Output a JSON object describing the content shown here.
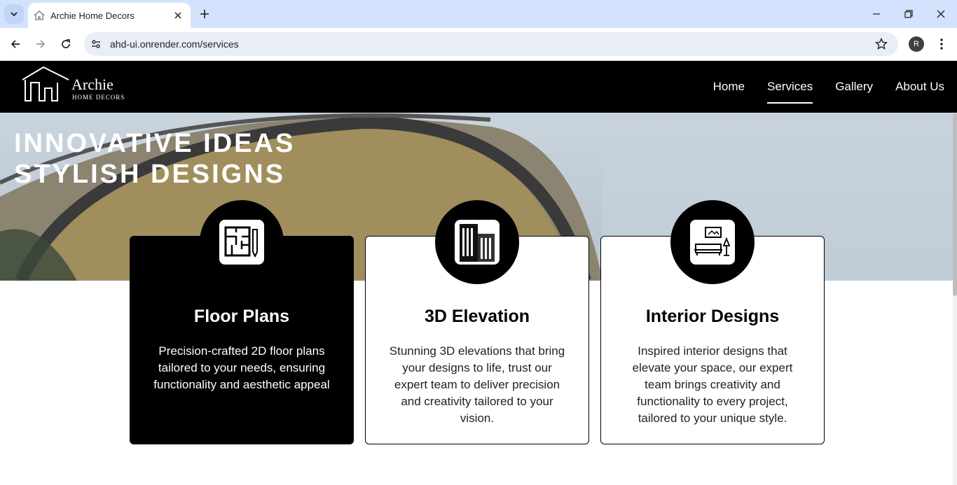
{
  "browser": {
    "tab_title": "Archie Home Decors",
    "url": "ahd-ui.onrender.com/services",
    "profile_initial": "R"
  },
  "site": {
    "logo": {
      "name": "Archie",
      "tagline": "HOME DECORS"
    },
    "nav": [
      {
        "label": "Home",
        "active": false
      },
      {
        "label": "Services",
        "active": true
      },
      {
        "label": "Gallery",
        "active": false
      },
      {
        "label": "About Us",
        "active": false
      }
    ],
    "hero": {
      "line1": "INNOVATIVE IDEAS",
      "line2": "STYLISH DESIGNS"
    },
    "services": [
      {
        "icon": "floor-plan-icon",
        "title": "Floor Plans",
        "description": "Precision-crafted 2D floor plans tailored to your needs, ensuring functionality and aesthetic appeal"
      },
      {
        "icon": "building-icon",
        "title": "3D Elevation",
        "description": "Stunning 3D elevations that bring your designs to life, trust our expert team to deliver precision and creativity tailored to your vision."
      },
      {
        "icon": "living-room-icon",
        "title": "Interior Designs",
        "description": "Inspired interior designs that elevate your space, our expert team brings creativity and functionality to every project, tailored to your unique style."
      }
    ]
  },
  "colors": {
    "header_bg": "#000000",
    "tabbar_bg": "#d3e3fd",
    "omnibox_bg": "#e9eef6"
  }
}
